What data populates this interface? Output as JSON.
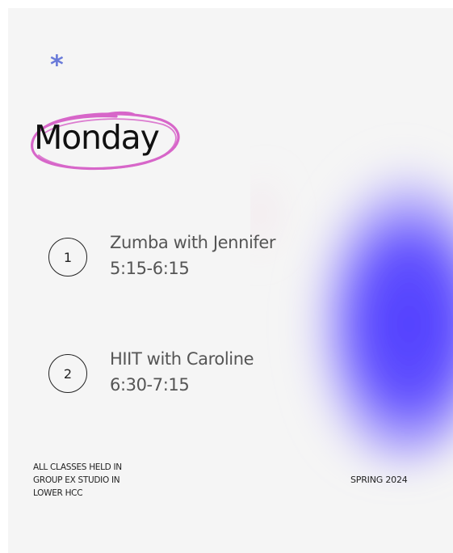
{
  "colors": {
    "background": "#f5f5f5",
    "accent_asterisk": "#6a7bd9",
    "circle_stroke": "#d766c9",
    "blob_primary": "#5a47ff",
    "text_primary": "#111111",
    "text_secondary": "#555555"
  },
  "decoration": {
    "asterisk": "*",
    "blob_icon": "purple-gradient-blob-icon",
    "scribble_icon": "pink-scribble-circle-icon"
  },
  "header": {
    "title": "Monday"
  },
  "classes": [
    {
      "number": "1",
      "name": "Zumba with Jennifer",
      "time": "5:15-6:15"
    },
    {
      "number": "2",
      "name": "HIIT with Caroline",
      "time": "6:30-7:15"
    }
  ],
  "footer": {
    "location_note": "ALL CLASSES HELD IN\nGROUP EX STUDIO IN\nLOWER HCC",
    "season": "SPRING 2024"
  }
}
